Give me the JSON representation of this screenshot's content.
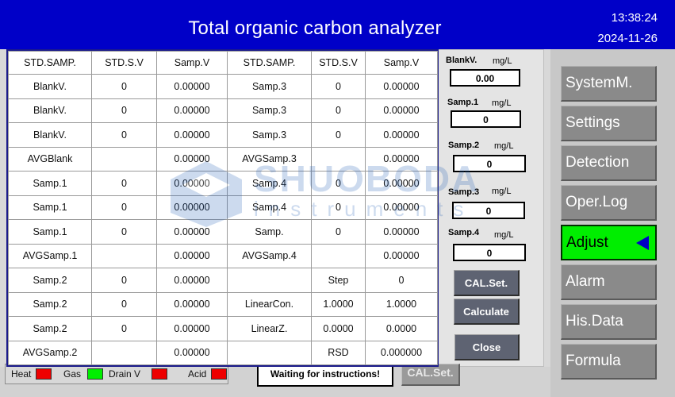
{
  "header": {
    "title": "Total organic carbon analyzer",
    "time": "13:38:24",
    "date": "2024-11-26"
  },
  "table": {
    "columns": [
      "STD.SAMP.",
      "STD.S.V",
      "Samp.V",
      "STD.SAMP.",
      "STD.S.V",
      "Samp.V"
    ],
    "rows": [
      [
        "BlankV.",
        "0",
        "0.00000",
        "Samp.3",
        "0",
        "0.00000"
      ],
      [
        "BlankV.",
        "0",
        "0.00000",
        "Samp.3",
        "0",
        "0.00000"
      ],
      [
        "BlankV.",
        "0",
        "0.00000",
        "Samp.3",
        "0",
        "0.00000"
      ],
      [
        "AVGBlank",
        "",
        "0.00000",
        "AVGSamp.3",
        "",
        "0.00000"
      ],
      [
        "Samp.1",
        "0",
        "0.00000",
        "Samp.4",
        "0",
        "0.00000"
      ],
      [
        "Samp.1",
        "0",
        "0.00000",
        "Samp.4",
        "0",
        "0.00000"
      ],
      [
        "Samp.1",
        "0",
        "0.00000",
        "Samp.",
        "0",
        "0.00000"
      ],
      [
        "AVGSamp.1",
        "",
        "0.00000",
        "AVGSamp.4",
        "",
        "0.00000"
      ],
      [
        "Samp.2",
        "0",
        "0.00000",
        "",
        "Step",
        "0"
      ],
      [
        "Samp.2",
        "0",
        "0.00000",
        "LinearCon.",
        "1.0000",
        "1.0000"
      ],
      [
        "Samp.2",
        "0",
        "0.00000",
        "LinearZ.",
        "0.0000",
        "0.0000"
      ],
      [
        "AVGSamp.2",
        "",
        "0.00000",
        "",
        "RSD",
        "0.000000"
      ]
    ]
  },
  "cal_panel": {
    "unit": "mg/L",
    "fields": [
      {
        "label": "BlankV.",
        "value": "0.00"
      },
      {
        "label": "Samp.1",
        "value": "0"
      },
      {
        "label": "Samp.2",
        "value": "0"
      },
      {
        "label": "Samp.3",
        "value": "0"
      },
      {
        "label": "Samp.4",
        "value": "0"
      }
    ],
    "cal_set_label": "CAL.Set.",
    "calculate_label": "Calculate",
    "close_label": "Close"
  },
  "nav": {
    "items": [
      {
        "label": "SystemM."
      },
      {
        "label": "Settings"
      },
      {
        "label": "Detection"
      },
      {
        "label": "Oper.Log"
      },
      {
        "label": "Adjust"
      },
      {
        "label": "Alarm"
      },
      {
        "label": "His.Data"
      },
      {
        "label": "Formula"
      }
    ],
    "active_color": "#00ee00"
  },
  "status": {
    "indicators": [
      {
        "label": "Heat",
        "color": "#ee0000"
      },
      {
        "label": "Gas",
        "color": "#00ee00"
      },
      {
        "label": "Drain V",
        "color": "#ee0000"
      },
      {
        "label": "Acid",
        "color": "#ee0000"
      }
    ],
    "message": "Waiting for instructions!",
    "cal_set_label": "CAL.Set."
  },
  "watermark": {
    "brand": "SHUOBODA",
    "sub": "instruments"
  }
}
